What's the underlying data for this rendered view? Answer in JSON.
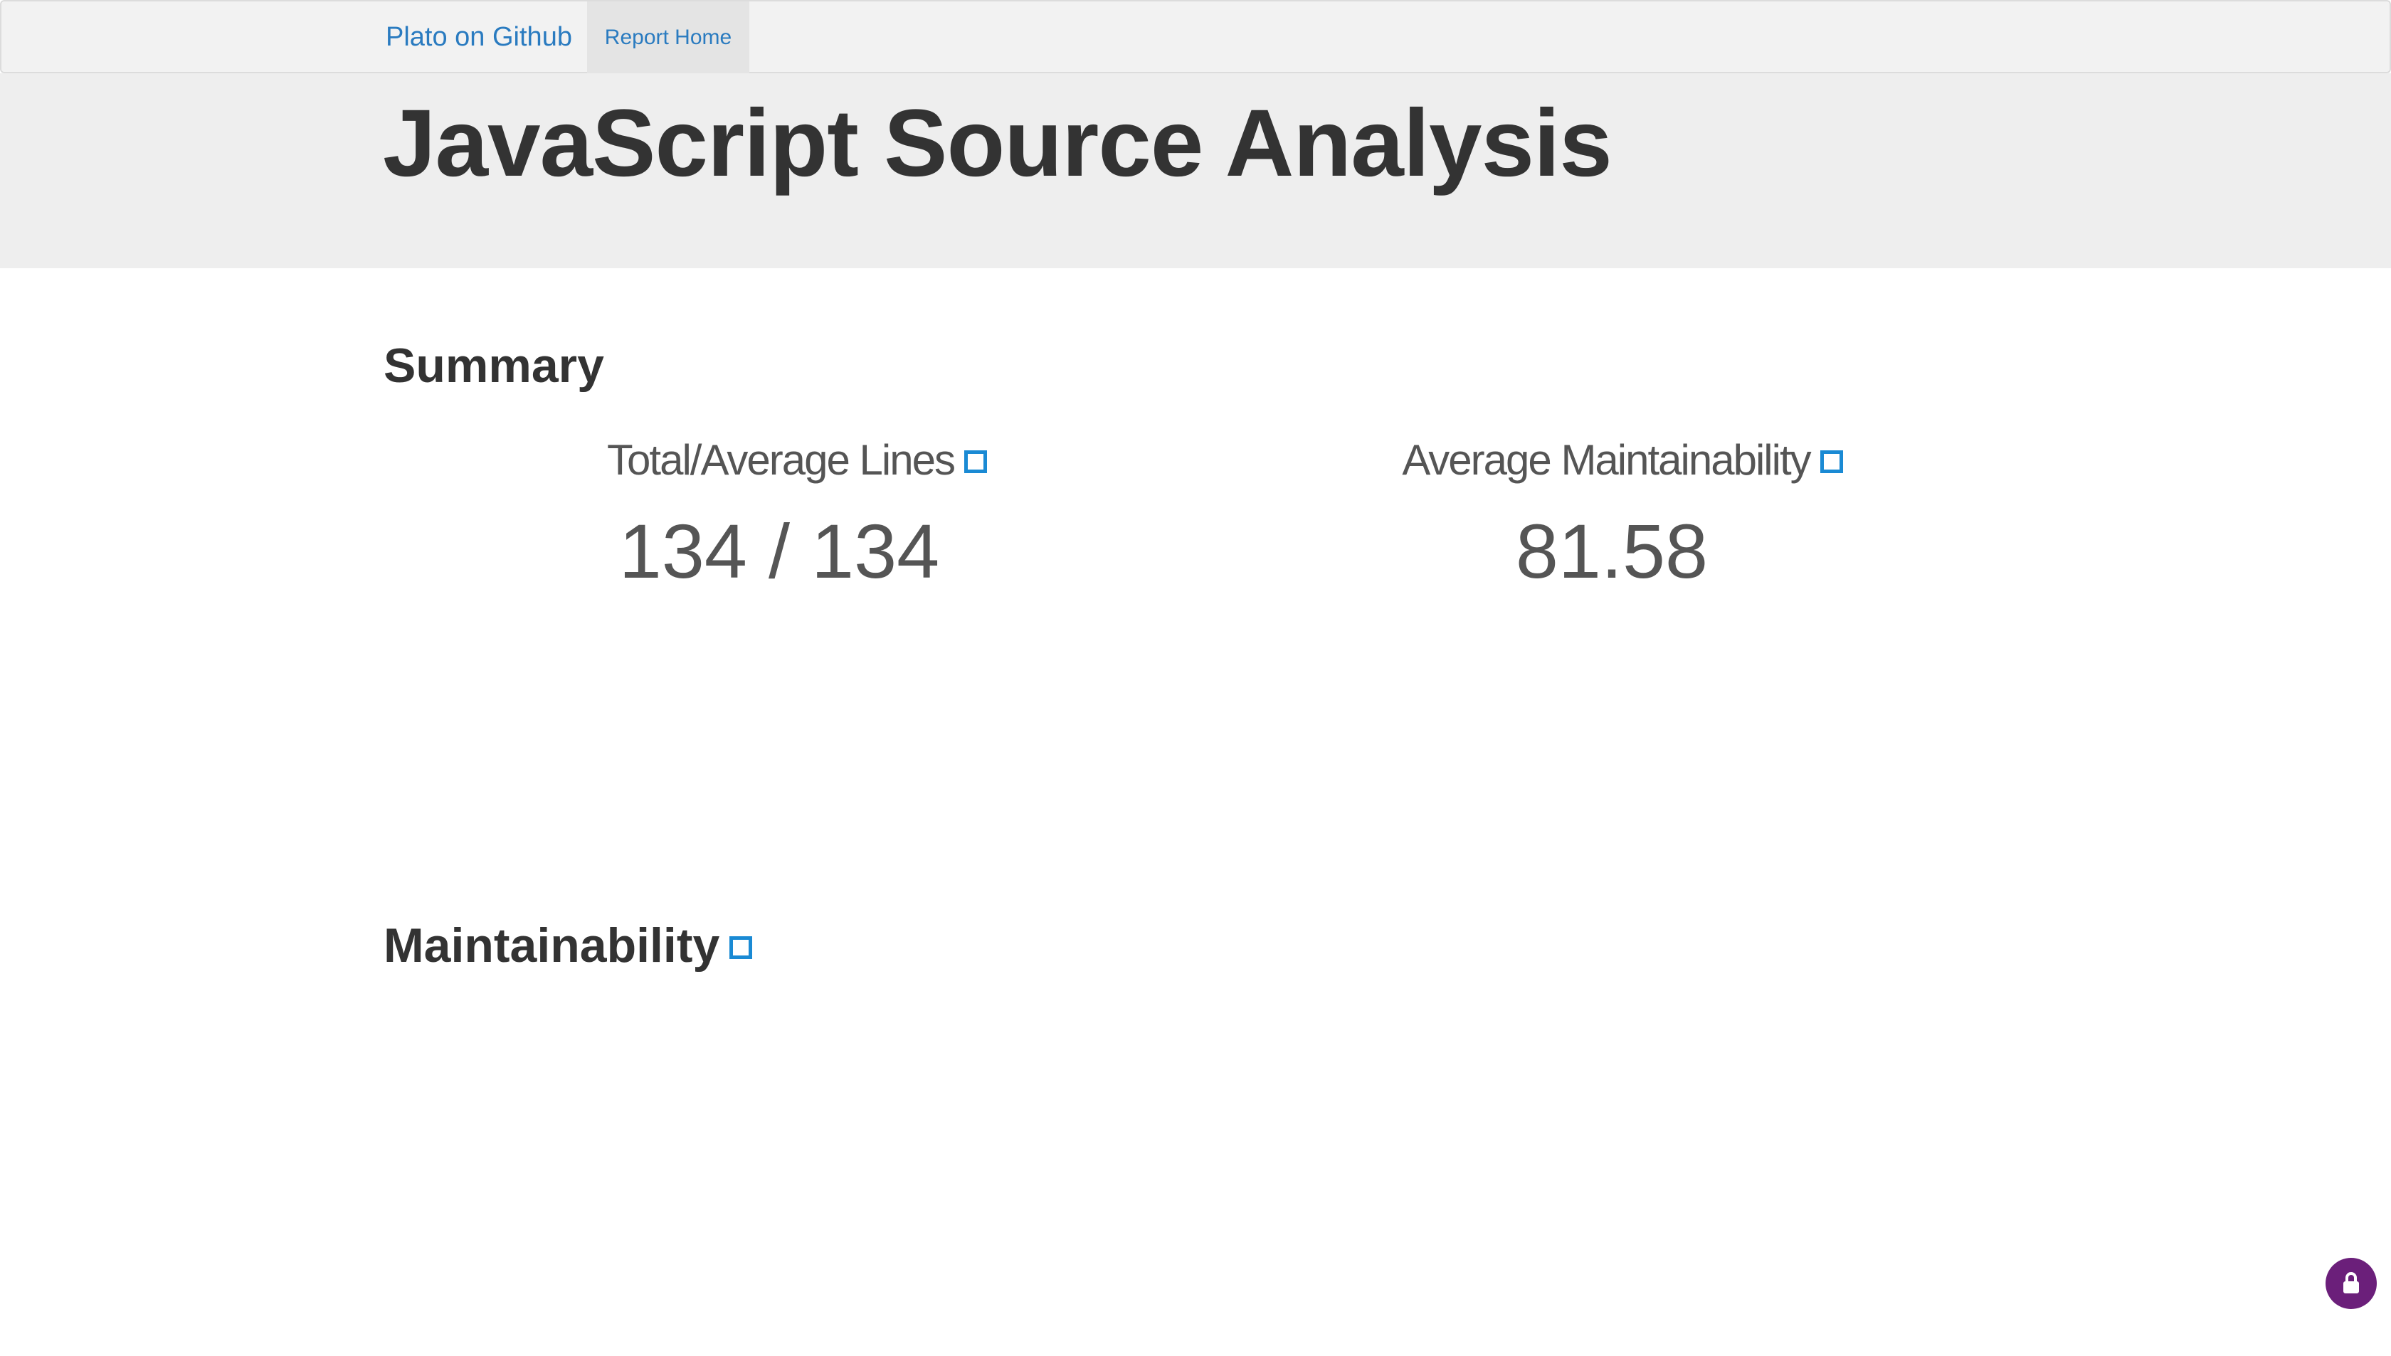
{
  "navbar": {
    "brand_label": "Plato on Github",
    "items": [
      {
        "label": "Report Home"
      }
    ]
  },
  "header": {
    "title": "JavaScript Source Analysis"
  },
  "summary": {
    "heading": "Summary",
    "stats": [
      {
        "label": "Total/Average Lines",
        "value": "134 / 134",
        "icon": "help-icon"
      },
      {
        "label": "Average Maintainability",
        "value": "81.58",
        "icon": "help-icon"
      }
    ]
  },
  "maintainability": {
    "heading": "Maintainability",
    "icon": "help-icon"
  },
  "colors": {
    "link": "#2a7bc0",
    "icon_border": "#1a8ad4",
    "badge": "#6b1f7a",
    "navbar_bg": "#f2f2f2",
    "jumbotron_bg": "#eeeeee"
  },
  "widgets": {
    "privacy_badge_icon": "lock-icon"
  }
}
